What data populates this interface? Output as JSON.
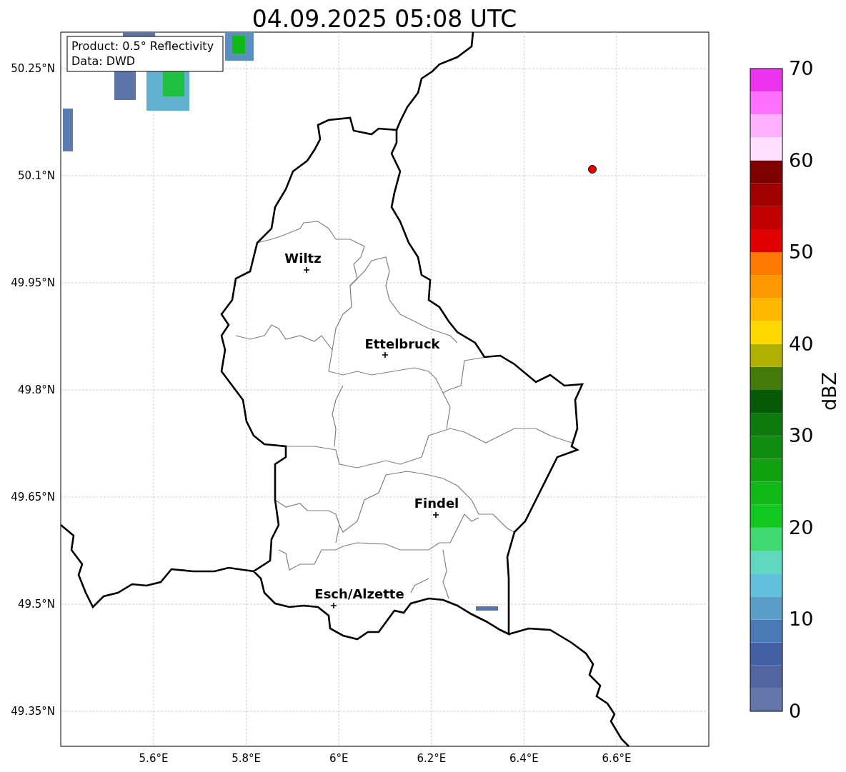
{
  "title": "04.09.2025 05:08 UTC",
  "info_box": {
    "lines": [
      "Product: 0.5° Reflectivity",
      "Data: DWD"
    ]
  },
  "map": {
    "lat_ticks": [
      "50.25°N",
      "50.1°N",
      "49.95°N",
      "49.8°N",
      "49.65°N",
      "49.5°N",
      "49.35°N"
    ],
    "lon_ticks": [
      "5.6°E",
      "5.8°E",
      "6°E",
      "6.2°E",
      "6.4°E",
      "6.6°E"
    ],
    "cities": [
      {
        "name": "Wiltz"
      },
      {
        "name": "Ettelbruck"
      },
      {
        "name": "Findel"
      },
      {
        "name": "Esch/Alzette"
      }
    ],
    "radar_site": {
      "color": "#ee0000"
    }
  },
  "colorbar": {
    "label": "dBZ",
    "ticks": [
      "70",
      "60",
      "50",
      "40",
      "30",
      "20",
      "10",
      "0"
    ],
    "segments": [
      {
        "color": "#6476aa"
      },
      {
        "color": "#5365a0"
      },
      {
        "color": "#4360a5"
      },
      {
        "color": "#4a7ab5"
      },
      {
        "color": "#5a9ec8"
      },
      {
        "color": "#62c0dc"
      },
      {
        "color": "#60d8c0"
      },
      {
        "color": "#40d870"
      },
      {
        "color": "#10c820"
      },
      {
        "color": "#10b818"
      },
      {
        "color": "#10a010"
      },
      {
        "color": "#108c10"
      },
      {
        "color": "#0c7a0c"
      },
      {
        "color": "#065a06"
      },
      {
        "color": "#447a0a"
      },
      {
        "color": "#b0b000"
      },
      {
        "color": "#ffd800"
      },
      {
        "color": "#ffb800"
      },
      {
        "color": "#ff9800"
      },
      {
        "color": "#ff7800"
      },
      {
        "color": "#e00000"
      },
      {
        "color": "#c00000"
      },
      {
        "color": "#a00000"
      },
      {
        "color": "#800000"
      },
      {
        "color": "#ffe0ff"
      },
      {
        "color": "#ffb0ff"
      },
      {
        "color": "#ff70ff"
      },
      {
        "color": "#ee33ee"
      }
    ]
  }
}
